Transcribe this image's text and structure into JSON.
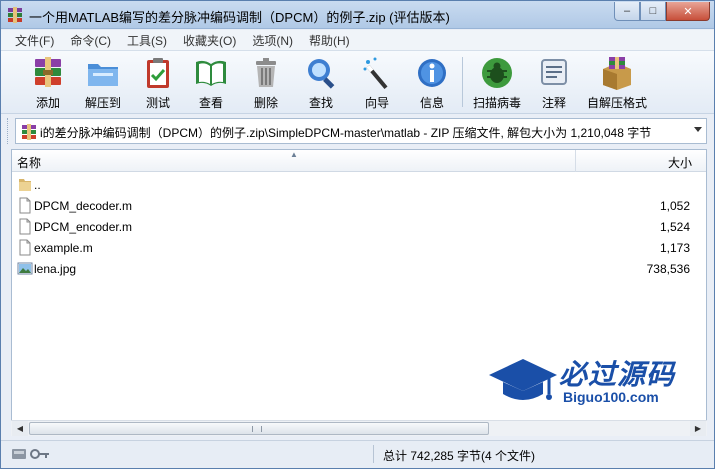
{
  "window": {
    "title": "一个用MATLAB编写的差分脉冲编码调制（DPCM）的例子.zip (评估版本)",
    "controls": {
      "minimize": "–",
      "maximize": "□",
      "close": "✕"
    }
  },
  "menu": [
    "文件(F)",
    "命令(C)",
    "工具(S)",
    "收藏夹(O)",
    "选项(N)",
    "帮助(H)"
  ],
  "toolbar": {
    "add": "添加",
    "extract": "解压到",
    "test": "测试",
    "view": "查看",
    "delete": "删除",
    "find": "查找",
    "wizard": "向导",
    "info": "信息",
    "virus_scan": "扫描病毒",
    "comment": "注释",
    "sfx": "自解压格式"
  },
  "address": {
    "text": "i的差分脉冲编码调制（DPCM）的例子.zip\\SimpleDPCM-master\\matlab - ZIP 压缩文件, 解包大小为 1,210,048 字节"
  },
  "list": {
    "columns": {
      "name": "名称",
      "size": "大小"
    },
    "rows": [
      {
        "name": "..",
        "size": "",
        "type": "folder"
      },
      {
        "name": "DPCM_decoder.m",
        "size": "1,052",
        "type": "file"
      },
      {
        "name": "DPCM_encoder.m",
        "size": "1,524",
        "type": "file"
      },
      {
        "name": "example.m",
        "size": "1,173",
        "type": "file"
      },
      {
        "name": "lena.jpg",
        "size": "738,536",
        "type": "image"
      }
    ]
  },
  "watermark": {
    "title": "必过源码",
    "subtitle": "Biguo100.com"
  },
  "status": {
    "text": "总计 742,285 字节(4 个文件)"
  },
  "colors": {
    "title_bg": "#b8cfea",
    "close_red": "#c74f3a",
    "brand_blue": "#1a4fa8"
  }
}
